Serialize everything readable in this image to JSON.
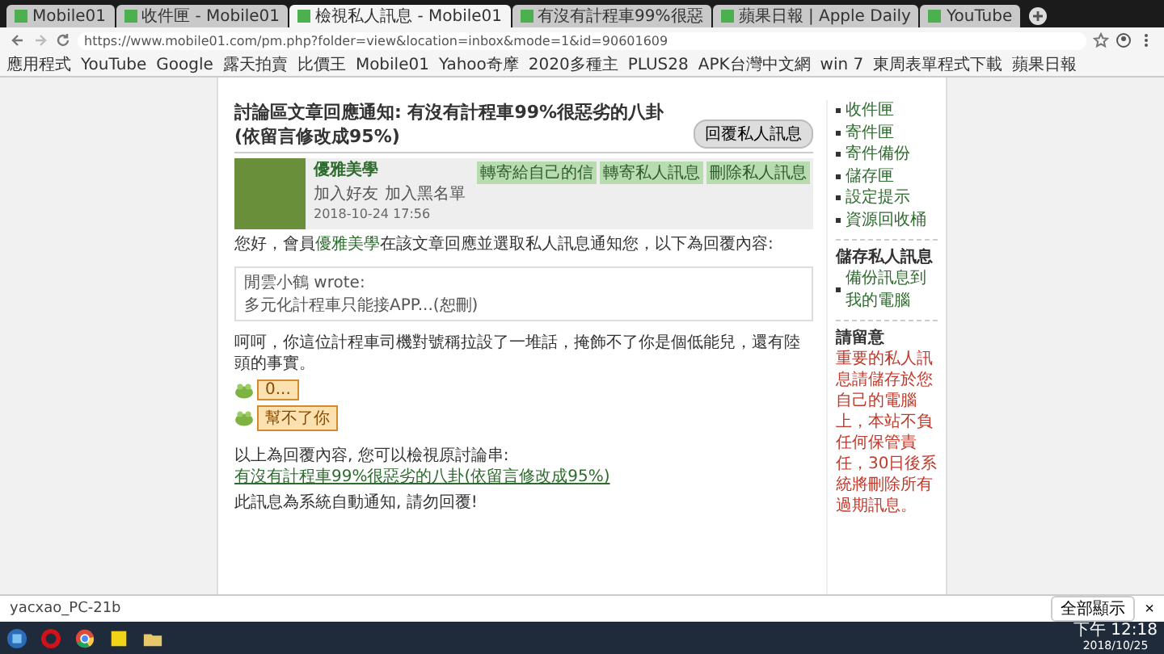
{
  "tabs": [
    {
      "label": "Mobile01",
      "selected": false
    },
    {
      "label": "收件匣 - Mobile01",
      "selected": false
    },
    {
      "label": "檢視私人訊息 - Mobile01",
      "selected": true
    },
    {
      "label": "有沒有計程車99%很惡",
      "selected": false
    },
    {
      "label": "蘋果日報 | Apple Daily",
      "selected": false
    },
    {
      "label": "YouTube",
      "selected": false
    }
  ],
  "address_bar": {
    "url": "https://www.mobile01.com/pm.php?folder=view&location=inbox&mode=1&id=90601609"
  },
  "bookmarks": [
    "應用程式",
    "YouTube",
    "Google",
    "露天拍賣",
    "比價王",
    "Mobile01",
    "Yahoo奇摩",
    "2020多種主",
    "PLUS28",
    "APK台灣中文網",
    "win 7",
    "東周表單程式下載",
    "蘋果日報"
  ],
  "message": {
    "title": "討論區文章回應通知: 有沒有計程車99%很惡劣的八卦(依留言修改成95%)",
    "reply_button": "回覆私人訊息",
    "sender": {
      "name": "優雅美學",
      "links": [
        "加入好友",
        "加入黑名單"
      ],
      "date": "2018-10-24 17:56",
      "actions": [
        "轉寄給自己的信",
        "轉寄私人訊息",
        "刪除私人訊息"
      ]
    },
    "intro": {
      "before": "您好，會員",
      "link": "優雅美學",
      "after": "在該文章回應並選取私人訊息通知您，以下為回覆內容:"
    },
    "quote": {
      "author": "閒雲小鶴 wrote:",
      "text": "多元化計程車只能接APP...(恕刪)"
    },
    "reply": "呵呵，你這位計程車司機對號稱拉設了一堆話，掩飾不了你是個低能兒，還有陸頭的事實。",
    "stickers": [
      "0...",
      "幫不了你"
    ],
    "footer": {
      "before": "以上為回覆內容, 您可以檢視原討論串: ",
      "link": "有沒有計程車99%很惡劣的八卦(依留言修改成95%)",
      "notice": "此訊息為系統自動通知, 請勿回覆!"
    }
  },
  "sidebar": {
    "folders": [
      "收件匣",
      "寄件匣",
      "寄件備份",
      "儲存匣",
      "設定提示",
      "資源回收桶"
    ],
    "save_heading": "儲存私人訊息",
    "save_link": "備份訊息到我的電腦",
    "notice_heading": "請留意",
    "notice": "重要的私人訊息請儲存於您自己的電腦上，本站不負任何保管責任，30日後系統將刪除所有過期訊息。"
  },
  "download_bar": {
    "file": "yacxao_PC-21b",
    "show_all": "全部顯示",
    "close": "×"
  },
  "taskbar": {
    "time": "下午 12:18",
    "date": "2018/10/25"
  }
}
